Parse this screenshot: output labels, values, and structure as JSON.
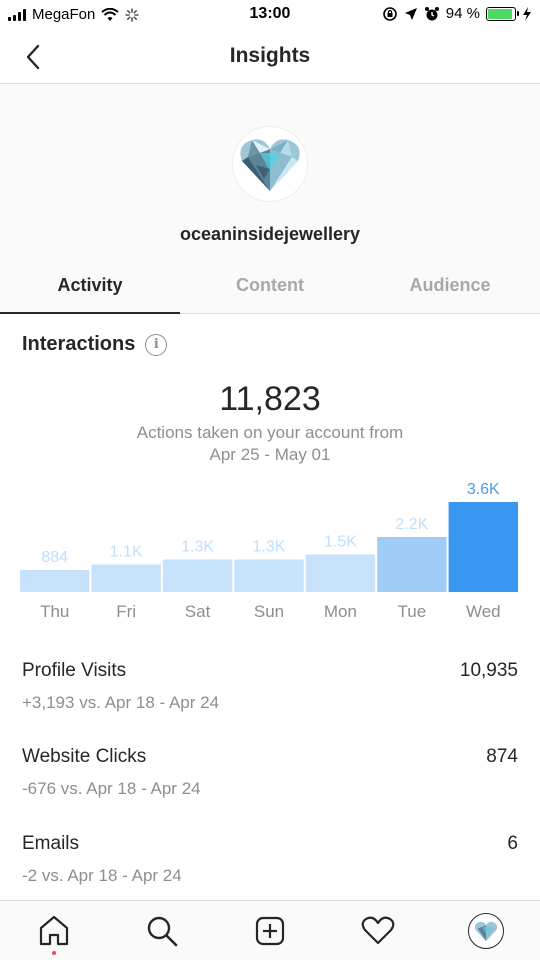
{
  "status_bar": {
    "carrier": "MegaFon",
    "time": "13:00",
    "battery_percent": "94 %",
    "battery_level": 0.94
  },
  "header": {
    "title": "Insights",
    "back_icon": "chevron-left-icon"
  },
  "profile": {
    "username": "oceaninsidejewellery",
    "avatar_icon": "diamond-heart-logo"
  },
  "tabs": [
    {
      "label": "Activity",
      "active": true
    },
    {
      "label": "Content",
      "active": false
    },
    {
      "label": "Audience",
      "active": false
    }
  ],
  "interactions": {
    "title": "Interactions",
    "total": "11,823",
    "subtitle_line1": "Actions taken on your account from",
    "subtitle_line2": "Apr 25 - May 01"
  },
  "chart_data": {
    "type": "bar",
    "categories": [
      "Thu",
      "Fri",
      "Sat",
      "Sun",
      "Mon",
      "Tue",
      "Wed"
    ],
    "values": [
      884,
      1100,
      1300,
      1300,
      1500,
      2200,
      3600
    ],
    "value_labels": [
      "884",
      "1.1K",
      "1.3K",
      "1.3K",
      "1.5K",
      "2.2K",
      "3.6K"
    ],
    "highlighted_index": 6,
    "colors": {
      "bar": "#c7e3fc",
      "bar_mid": "#9fcdf8",
      "highlight": "#3897f0"
    },
    "ylim": [
      0,
      3600
    ]
  },
  "metrics": [
    {
      "label": "Profile Visits",
      "value": "10,935",
      "sub": "+3,193 vs. Apr 18 - Apr 24"
    },
    {
      "label": "Website Clicks",
      "value": "874",
      "sub": "-676 vs. Apr 18 - Apr 24"
    },
    {
      "label": "Emails",
      "value": "6",
      "sub": "-2 vs. Apr 18 - Apr 24"
    }
  ],
  "bottom_nav": [
    {
      "icon": "home-icon"
    },
    {
      "icon": "search-icon"
    },
    {
      "icon": "add-post-icon"
    },
    {
      "icon": "heart-icon"
    },
    {
      "icon": "profile-avatar-icon"
    }
  ]
}
